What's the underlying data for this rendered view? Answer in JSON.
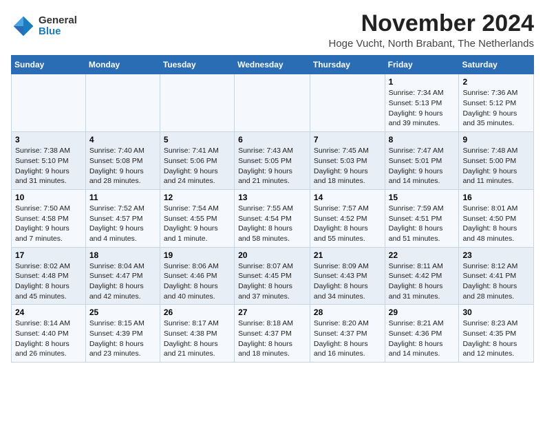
{
  "header": {
    "logo_general": "General",
    "logo_blue": "Blue",
    "title": "November 2024",
    "location": "Hoge Vucht, North Brabant, The Netherlands"
  },
  "weekdays": [
    "Sunday",
    "Monday",
    "Tuesday",
    "Wednesday",
    "Thursday",
    "Friday",
    "Saturday"
  ],
  "weeks": [
    [
      {
        "day": "",
        "detail": ""
      },
      {
        "day": "",
        "detail": ""
      },
      {
        "day": "",
        "detail": ""
      },
      {
        "day": "",
        "detail": ""
      },
      {
        "day": "",
        "detail": ""
      },
      {
        "day": "1",
        "detail": "Sunrise: 7:34 AM\nSunset: 5:13 PM\nDaylight: 9 hours\nand 39 minutes."
      },
      {
        "day": "2",
        "detail": "Sunrise: 7:36 AM\nSunset: 5:12 PM\nDaylight: 9 hours\nand 35 minutes."
      }
    ],
    [
      {
        "day": "3",
        "detail": "Sunrise: 7:38 AM\nSunset: 5:10 PM\nDaylight: 9 hours\nand 31 minutes."
      },
      {
        "day": "4",
        "detail": "Sunrise: 7:40 AM\nSunset: 5:08 PM\nDaylight: 9 hours\nand 28 minutes."
      },
      {
        "day": "5",
        "detail": "Sunrise: 7:41 AM\nSunset: 5:06 PM\nDaylight: 9 hours\nand 24 minutes."
      },
      {
        "day": "6",
        "detail": "Sunrise: 7:43 AM\nSunset: 5:05 PM\nDaylight: 9 hours\nand 21 minutes."
      },
      {
        "day": "7",
        "detail": "Sunrise: 7:45 AM\nSunset: 5:03 PM\nDaylight: 9 hours\nand 18 minutes."
      },
      {
        "day": "8",
        "detail": "Sunrise: 7:47 AM\nSunset: 5:01 PM\nDaylight: 9 hours\nand 14 minutes."
      },
      {
        "day": "9",
        "detail": "Sunrise: 7:48 AM\nSunset: 5:00 PM\nDaylight: 9 hours\nand 11 minutes."
      }
    ],
    [
      {
        "day": "10",
        "detail": "Sunrise: 7:50 AM\nSunset: 4:58 PM\nDaylight: 9 hours\nand 7 minutes."
      },
      {
        "day": "11",
        "detail": "Sunrise: 7:52 AM\nSunset: 4:57 PM\nDaylight: 9 hours\nand 4 minutes."
      },
      {
        "day": "12",
        "detail": "Sunrise: 7:54 AM\nSunset: 4:55 PM\nDaylight: 9 hours\nand 1 minute."
      },
      {
        "day": "13",
        "detail": "Sunrise: 7:55 AM\nSunset: 4:54 PM\nDaylight: 8 hours\nand 58 minutes."
      },
      {
        "day": "14",
        "detail": "Sunrise: 7:57 AM\nSunset: 4:52 PM\nDaylight: 8 hours\nand 55 minutes."
      },
      {
        "day": "15",
        "detail": "Sunrise: 7:59 AM\nSunset: 4:51 PM\nDaylight: 8 hours\nand 51 minutes."
      },
      {
        "day": "16",
        "detail": "Sunrise: 8:01 AM\nSunset: 4:50 PM\nDaylight: 8 hours\nand 48 minutes."
      }
    ],
    [
      {
        "day": "17",
        "detail": "Sunrise: 8:02 AM\nSunset: 4:48 PM\nDaylight: 8 hours\nand 45 minutes."
      },
      {
        "day": "18",
        "detail": "Sunrise: 8:04 AM\nSunset: 4:47 PM\nDaylight: 8 hours\nand 42 minutes."
      },
      {
        "day": "19",
        "detail": "Sunrise: 8:06 AM\nSunset: 4:46 PM\nDaylight: 8 hours\nand 40 minutes."
      },
      {
        "day": "20",
        "detail": "Sunrise: 8:07 AM\nSunset: 4:45 PM\nDaylight: 8 hours\nand 37 minutes."
      },
      {
        "day": "21",
        "detail": "Sunrise: 8:09 AM\nSunset: 4:43 PM\nDaylight: 8 hours\nand 34 minutes."
      },
      {
        "day": "22",
        "detail": "Sunrise: 8:11 AM\nSunset: 4:42 PM\nDaylight: 8 hours\nand 31 minutes."
      },
      {
        "day": "23",
        "detail": "Sunrise: 8:12 AM\nSunset: 4:41 PM\nDaylight: 8 hours\nand 28 minutes."
      }
    ],
    [
      {
        "day": "24",
        "detail": "Sunrise: 8:14 AM\nSunset: 4:40 PM\nDaylight: 8 hours\nand 26 minutes."
      },
      {
        "day": "25",
        "detail": "Sunrise: 8:15 AM\nSunset: 4:39 PM\nDaylight: 8 hours\nand 23 minutes."
      },
      {
        "day": "26",
        "detail": "Sunrise: 8:17 AM\nSunset: 4:38 PM\nDaylight: 8 hours\nand 21 minutes."
      },
      {
        "day": "27",
        "detail": "Sunrise: 8:18 AM\nSunset: 4:37 PM\nDaylight: 8 hours\nand 18 minutes."
      },
      {
        "day": "28",
        "detail": "Sunrise: 8:20 AM\nSunset: 4:37 PM\nDaylight: 8 hours\nand 16 minutes."
      },
      {
        "day": "29",
        "detail": "Sunrise: 8:21 AM\nSunset: 4:36 PM\nDaylight: 8 hours\nand 14 minutes."
      },
      {
        "day": "30",
        "detail": "Sunrise: 8:23 AM\nSunset: 4:35 PM\nDaylight: 8 hours\nand 12 minutes."
      }
    ]
  ]
}
